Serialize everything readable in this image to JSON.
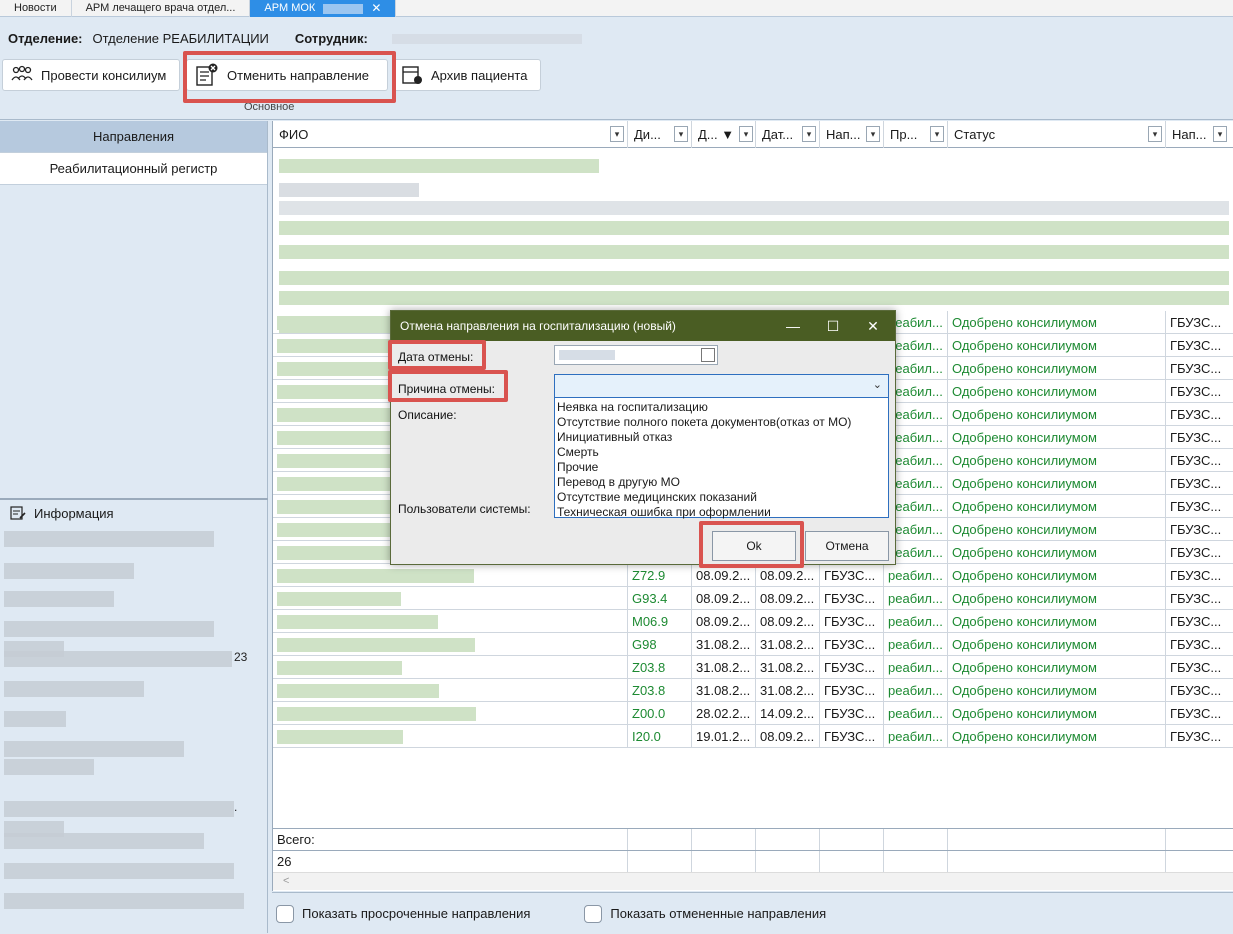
{
  "tabs": [
    {
      "label": "Новости"
    },
    {
      "label": "АРМ лечащего врача отдел..."
    },
    {
      "label": "АРМ МОК",
      "active": true
    }
  ],
  "header": {
    "dept_label": "Отделение:",
    "dept_value": "Отделение РЕАБИЛИТАЦИИ",
    "employee_label": "Сотрудник:",
    "group_label": "Основное"
  },
  "toolbar": {
    "consilium": "Провести консилиум",
    "cancel_direction": "Отменить направление",
    "archive": "Архив пациента"
  },
  "left_nav": {
    "directions": "Направления",
    "rehab_register": "Реабилитационный регистр",
    "info": "Информация",
    "info_tail_a": "23",
    "info_tail_b": "."
  },
  "grid": {
    "headers": [
      "ФИО",
      "Ди...",
      "Д...",
      "Дат...",
      "Нап...",
      "Пр...",
      "Статус",
      "Нап..."
    ],
    "rows": [
      {
        "diag": "",
        "d1": "",
        "d2": "",
        "org": "",
        "prof": "реабил...",
        "status": "Одобрено консилиумом",
        "dir": "ГБУЗС..."
      },
      {
        "diag": "",
        "d1": "",
        "d2": "",
        "org": "",
        "prof": "реабил...",
        "status": "Одобрено консилиумом",
        "dir": "ГБУЗС..."
      },
      {
        "diag": "",
        "d1": "",
        "d2": "",
        "org": "",
        "prof": "реабил...",
        "status": "Одобрено консилиумом",
        "dir": "ГБУЗС..."
      },
      {
        "diag": "",
        "d1": "",
        "d2": "",
        "org": "",
        "prof": "реабил...",
        "status": "Одобрено консилиумом",
        "dir": "ГБУЗС..."
      },
      {
        "diag": "",
        "d1": "",
        "d2": "",
        "org": "",
        "prof": "реабил...",
        "status": "Одобрено консилиумом",
        "dir": "ГБУЗС..."
      },
      {
        "diag": "",
        "d1": "",
        "d2": "",
        "org": "",
        "prof": "реабил...",
        "status": "Одобрено консилиумом",
        "dir": "ГБУЗС..."
      },
      {
        "diag": "",
        "d1": "",
        "d2": "",
        "org": "",
        "prof": "реабил...",
        "status": "Одобрено консилиумом",
        "dir": "ГБУЗС..."
      },
      {
        "diag": "",
        "d1": "",
        "d2": "",
        "org": "",
        "prof": "реабил...",
        "status": "Одобрено консилиумом",
        "dir": "ГБУЗС..."
      },
      {
        "diag": "",
        "d1": "",
        "d2": "",
        "org": "",
        "prof": "реабил...",
        "status": "Одобрено консилиумом",
        "dir": "ГБУЗС..."
      },
      {
        "diag": "",
        "d1": "",
        "d2": "",
        "org": "",
        "prof": "реабил...",
        "status": "Одобрено консилиумом",
        "dir": "ГБУЗС..."
      },
      {
        "diag": "",
        "d1": "",
        "d2": "",
        "org": "",
        "prof": "реабил...",
        "status": "Одобрено консилиумом",
        "dir": "ГБУЗС..."
      },
      {
        "diag": "Z72.9",
        "d1": "08.09.2...",
        "d2": "08.09.2...",
        "org": "ГБУЗС...",
        "prof": "реабил...",
        "status": "Одобрено консилиумом",
        "dir": "ГБУЗС..."
      },
      {
        "diag": "G93.4",
        "d1": "08.09.2...",
        "d2": "08.09.2...",
        "org": "ГБУЗС...",
        "prof": "реабил...",
        "status": "Одобрено консилиумом",
        "dir": "ГБУЗС..."
      },
      {
        "diag": "M06.9",
        "d1": "08.09.2...",
        "d2": "08.09.2...",
        "org": "ГБУЗС...",
        "prof": "реабил...",
        "status": "Одобрено консилиумом",
        "dir": "ГБУЗС..."
      },
      {
        "diag": "G98",
        "d1": "31.08.2...",
        "d2": "31.08.2...",
        "org": "ГБУЗС...",
        "prof": "реабил...",
        "status": "Одобрено консилиумом",
        "dir": "ГБУЗС..."
      },
      {
        "diag": "Z03.8",
        "d1": "31.08.2...",
        "d2": "31.08.2...",
        "org": "ГБУЗС...",
        "prof": "реабил...",
        "status": "Одобрено консилиумом",
        "dir": "ГБУЗС..."
      },
      {
        "diag": "Z03.8",
        "d1": "31.08.2...",
        "d2": "31.08.2...",
        "org": "ГБУЗС...",
        "prof": "реабил...",
        "status": "Одобрено консилиумом",
        "dir": "ГБУЗС..."
      },
      {
        "diag": "Z00.0",
        "d1": "28.02.2...",
        "d2": "14.09.2...",
        "org": "ГБУЗС...",
        "prof": "реабил...",
        "status": "Одобрено консилиумом",
        "dir": "ГБУЗС..."
      },
      {
        "diag": "I20.0",
        "d1": "19.01.2...",
        "d2": "08.09.2...",
        "org": "ГБУЗС...",
        "prof": "реабил...",
        "status": "Одобрено консилиумом",
        "dir": "ГБУЗС..."
      }
    ],
    "total_label": "Всего:",
    "total_value": "26",
    "scroll_left": "<"
  },
  "footer": {
    "show_overdue": "Показать просроченные направления",
    "show_cancelled": "Показать отмененные направления"
  },
  "dialog": {
    "title": "Отмена направления на госпитализацию (новый)",
    "cancel_date_label": "Дата отмены:",
    "reason_label": "Причина отмены:",
    "description_label": "Описание:",
    "users_label": "Пользователи системы:",
    "reasons": [
      "Неявка на госпитализацию",
      "Отсутствие полного покета документов(отказ от МО)",
      "Инициативный отказ",
      "Смерть",
      "Прочие",
      "Перевод в другую МО",
      "Отсутствие медицинских показаний",
      "Техническая ошибка при оформлении"
    ],
    "ok": "Ok",
    "cancel": "Отмена",
    "minimize": "—",
    "maximize": "☐",
    "close": "✕"
  },
  "colors": {
    "accent_tab": "#2e8ee6",
    "dialog_title": "#4a5d23",
    "status_green": "#1d8a32",
    "highlight": "#d9534f"
  }
}
